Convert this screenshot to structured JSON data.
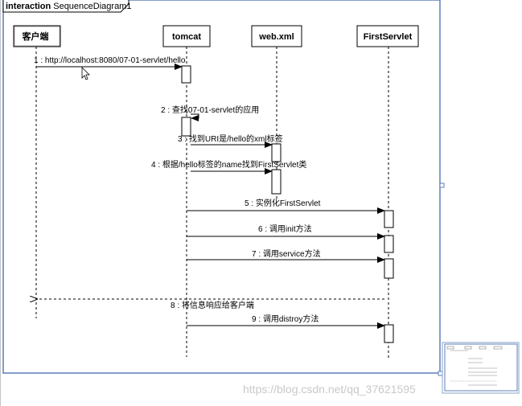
{
  "frame": {
    "kind": "interaction",
    "name": "SequenceDiagram1"
  },
  "lifelines": [
    {
      "id": "client",
      "label": "客户端"
    },
    {
      "id": "tomcat",
      "label": "tomcat"
    },
    {
      "id": "webxml",
      "label": "web.xml"
    },
    {
      "id": "servlet",
      "label": "FirstServlet"
    }
  ],
  "messages": [
    {
      "label": "1 : http://localhost:8080/07-01-servlet/hello",
      "from": "client",
      "to": "tomcat",
      "kind": "call"
    },
    {
      "label": "2 : 查找07-01-servlet的应用",
      "from": "tomcat",
      "to": "tomcat",
      "kind": "self"
    },
    {
      "label": "3 : 找到URI是/hello的xml标签",
      "from": "tomcat",
      "to": "webxml",
      "kind": "call"
    },
    {
      "label": "4 : 根据/hello标签的name找到FirstServlet类",
      "from": "tomcat",
      "to": "webxml",
      "kind": "call"
    },
    {
      "label": "5 : 实例化FirstServlet",
      "from": "tomcat",
      "to": "servlet",
      "kind": "call"
    },
    {
      "label": "6 : 调用init方法",
      "from": "tomcat",
      "to": "servlet",
      "kind": "call"
    },
    {
      "label": "7 : 调用service方法",
      "from": "tomcat",
      "to": "servlet",
      "kind": "call"
    },
    {
      "label": "8 : 将信息响应给客户端",
      "from": "servlet",
      "to": "client",
      "kind": "return"
    },
    {
      "label": "9 : 调用distroy方法",
      "from": "tomcat",
      "to": "servlet",
      "kind": "call"
    }
  ],
  "watermark": "https://blog.csdn.net/qq_37621595"
}
